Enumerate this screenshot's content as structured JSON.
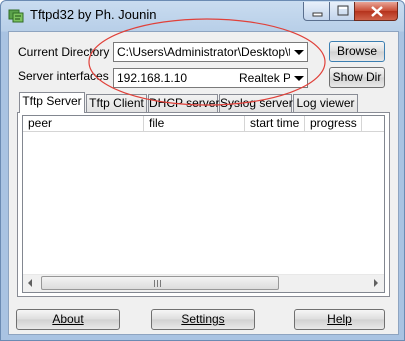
{
  "window": {
    "title": "Tftpd32 by Ph. Jounin",
    "icon": "tftpd32-app-icon"
  },
  "form": {
    "current_directory_label": "Current Directory",
    "current_directory_value": "C:\\Users\\Administrator\\Desktop\\tftp",
    "browse_label": "Browse",
    "server_interfaces_label": "Server interfaces",
    "server_interface_ip": "192.168.1.10",
    "server_interface_adapter": "Realtek PC",
    "show_dir_label": "Show Dir"
  },
  "tabs": [
    {
      "label": "Tftp Server",
      "active": true
    },
    {
      "label": "Tftp Client",
      "active": false
    },
    {
      "label": "DHCP server",
      "active": false
    },
    {
      "label": "Syslog server",
      "active": false
    },
    {
      "label": "Log viewer",
      "active": false
    }
  ],
  "table": {
    "columns": [
      "peer",
      "file",
      "start time",
      "progress"
    ],
    "rows": []
  },
  "footer": {
    "about_label": "About",
    "settings_label": "Settings",
    "help_label": "Help"
  },
  "colors": {
    "annotation_oval": "#e0413a"
  }
}
